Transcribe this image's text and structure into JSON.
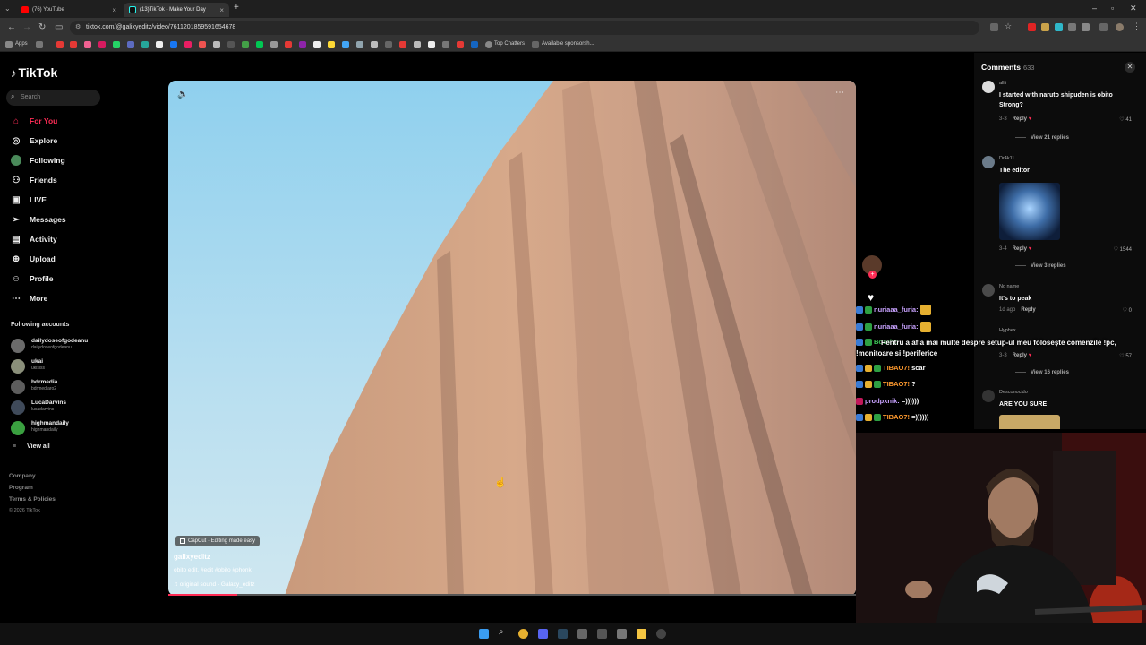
{
  "browser": {
    "tabs": [
      {
        "title": "(76) YouTube"
      },
      {
        "title": "(13)TikTok - Make Your Day"
      }
    ],
    "new_tab": "+",
    "url": "tiktok.com/@galixyeditz/video/7611201859591654678",
    "bookmarks": {
      "apps": "Apps",
      "top_chatters": "Top Chatters",
      "available": "Available sponsorsh..."
    }
  },
  "sidebar": {
    "brand": "TikTok",
    "search_placeholder": "Search",
    "nav": [
      {
        "label": "For You",
        "icon": "home-icon"
      },
      {
        "label": "Explore",
        "icon": "compass-icon"
      },
      {
        "label": "Following",
        "icon": "following-icon"
      },
      {
        "label": "Friends",
        "icon": "friends-icon"
      },
      {
        "label": "LIVE",
        "icon": "live-icon"
      },
      {
        "label": "Messages",
        "icon": "messages-icon"
      },
      {
        "label": "Activity",
        "icon": "activity-icon"
      },
      {
        "label": "Upload",
        "icon": "upload-icon"
      },
      {
        "label": "Profile",
        "icon": "profile-icon"
      },
      {
        "label": "More",
        "icon": "more-icon"
      }
    ],
    "following_title": "Following accounts",
    "accounts": [
      {
        "name": "dailydoseofgodeanu",
        "handle": "dailydoseofgodeanu"
      },
      {
        "name": "ukai",
        "handle": "uklsiss"
      },
      {
        "name": "bdrmedia",
        "handle": "bdrmediaro2"
      },
      {
        "name": "LucaDarvins",
        "handle": "lucadarvins"
      },
      {
        "name": "highmandaily",
        "handle": "highmandaily"
      }
    ],
    "view_all": "View all",
    "footer": {
      "company": "Company",
      "program": "Program",
      "terms": "Terms & Policies",
      "copyright": "© 2026 TikTok"
    }
  },
  "video": {
    "capcut": "CapCut · Editing made easy",
    "author": "galixyeditz",
    "description": "obito edit. #edit #obito #phonk",
    "sound": "original sound - Galaxy_editz",
    "progress": 0.1
  },
  "comments": {
    "title": "Comments",
    "count": "633",
    "items": [
      {
        "user": "allii",
        "text": "I started with naruto shipuden is obito Strong?",
        "date": "3-3",
        "reply": "Reply",
        "likes": "41",
        "replies": "View 21 replies"
      },
      {
        "user": "Dr4k11",
        "text": "The editor",
        "date": "3-4",
        "reply": "Reply",
        "likes": "1544",
        "replies": "View 3 replies"
      },
      {
        "user": "No name",
        "text": "It's to peak",
        "date": "1d ago",
        "reply": "Reply",
        "likes": "0"
      },
      {
        "user": "Hyphex",
        "date": "3-3",
        "reply": "Reply",
        "likes": "57",
        "replies": "View 16 replies"
      },
      {
        "user": "Desconocido",
        "text": "ARE YOU SURE"
      }
    ]
  },
  "stream_chat": [
    {
      "name": "nuriaaa_furia:",
      "msg": ""
    },
    {
      "name": "nuriaaa_furia:",
      "msg": ""
    },
    {
      "name": "BotRix:",
      "msg": "Pentru a afla mai multe despre setup-ul meu folosește comenzile !pc, !monitoare si !periferice"
    },
    {
      "name": "TIBAO7!",
      "msg": "scar"
    },
    {
      "name": "TIBAO7!",
      "msg": "?"
    },
    {
      "name": "prodpxnik:",
      "msg": "=))))))"
    },
    {
      "name": "TIBAO7!",
      "msg": "=))))))"
    }
  ],
  "colors": {
    "accent": "#fe2c55",
    "bg": "#000000"
  }
}
